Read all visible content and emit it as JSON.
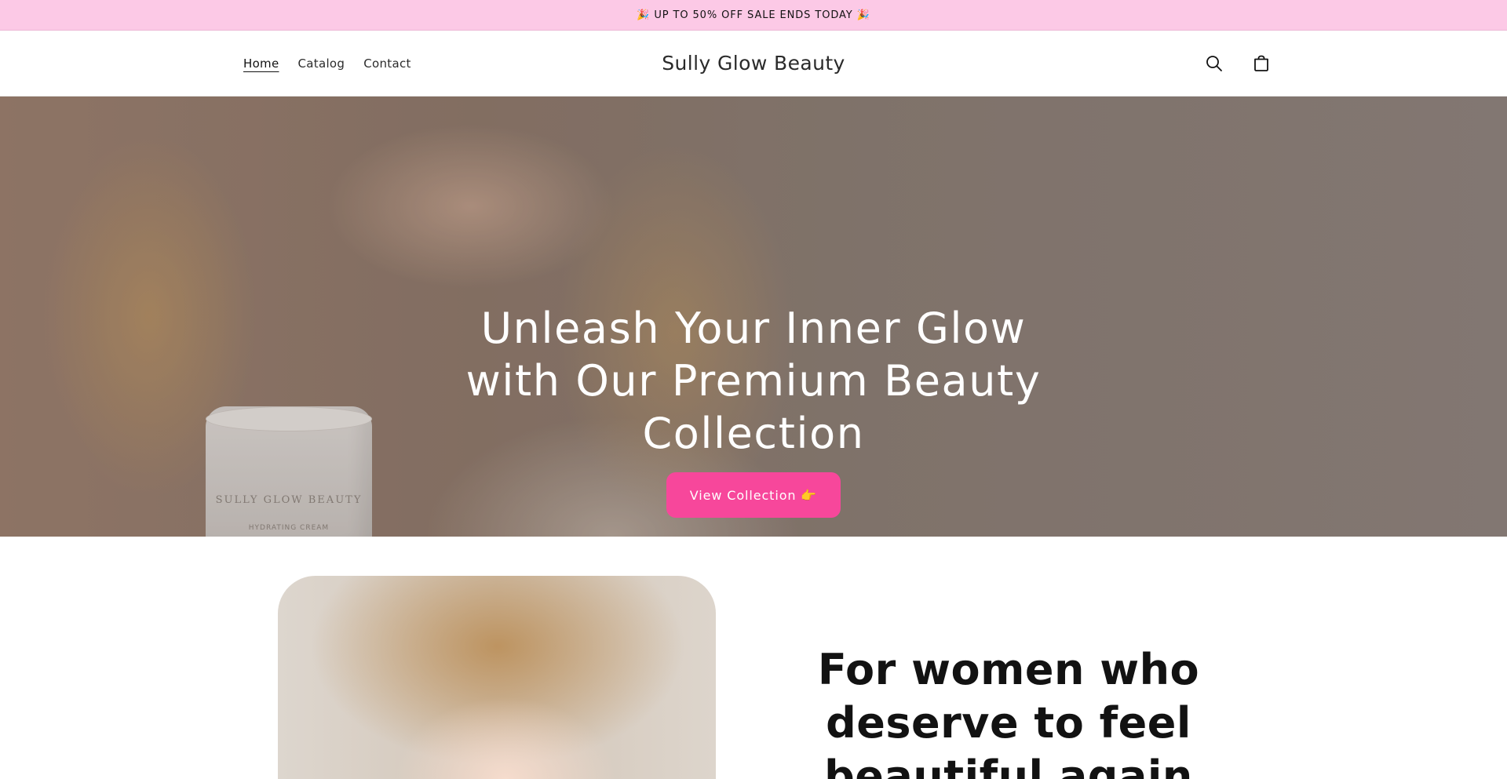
{
  "announcement": {
    "text": "🎉 UP TO 50% OFF SALE ENDS TODAY 🎉"
  },
  "header": {
    "nav": [
      {
        "label": "Home",
        "active": true
      },
      {
        "label": "Catalog",
        "active": false
      },
      {
        "label": "Contact",
        "active": false
      }
    ],
    "logo": "Sully Glow Beauty",
    "icons": [
      "search-icon",
      "cart-icon"
    ]
  },
  "hero": {
    "title": "Unleash Your Inner Glow with Our Premium Beauty Collection",
    "button_label": "View Collection 👉",
    "jar_text": "SULLY GLOW BEAUTY",
    "jar_small_text": "HYDRATING CREAM"
  },
  "feature": {
    "heading": "For women who deserve to feel beautiful again"
  },
  "colors": {
    "announcement_bg": "#fcc9e6",
    "button_bg": "#f7479b",
    "text": "#121212"
  }
}
